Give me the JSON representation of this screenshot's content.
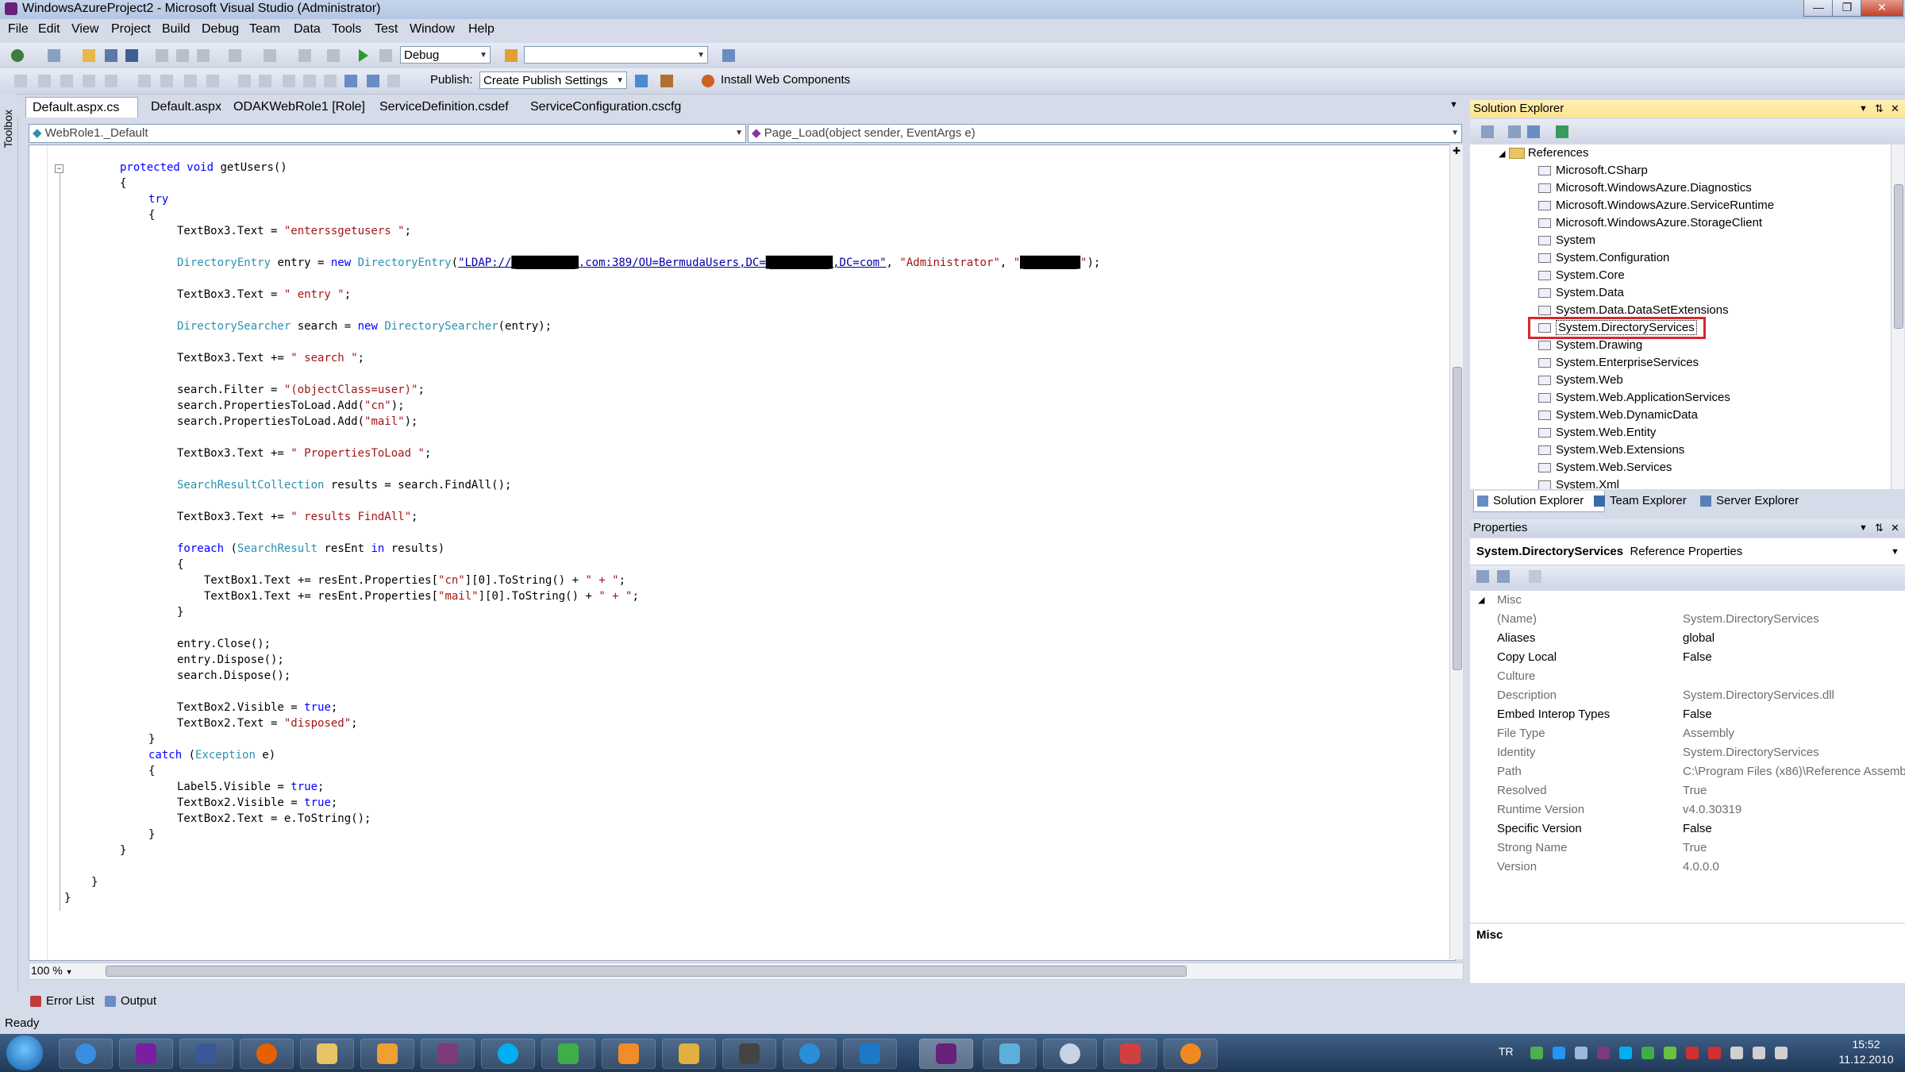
{
  "window": {
    "title": "WindowsAzureProject2 - Microsoft Visual Studio (Administrator)"
  },
  "menu": [
    "File",
    "Edit",
    "View",
    "Project",
    "Build",
    "Debug",
    "Team",
    "Data",
    "Tools",
    "Test",
    "Window",
    "Help"
  ],
  "toolbar": {
    "config": "Debug",
    "publish_label": "Publish:",
    "publish_value": "Create Publish Settings",
    "install_label": "Install Web Components"
  },
  "toolbox_label": "Toolbox",
  "tabs": [
    "Default.aspx.cs",
    "Default.aspx",
    "ODAKWebRole1 [Role]",
    "ServiceDefinition.csdef",
    "ServiceConfiguration.cscfg"
  ],
  "navbar": {
    "class": "WebRole1._Default",
    "member": "Page_Load(object sender, EventArgs e)"
  },
  "code": {
    "l1a": "protected",
    "l1b": "void",
    "l1c": " getUsers()",
    "l2": "{",
    "l3": "try",
    "l4": "{",
    "l5a": "TextBox3.Text = ",
    "l5b": "\"enterssgetusers \"",
    "l5c": ";",
    "l6a": "DirectoryEntry",
    "l6b": " entry = ",
    "l6c": "new",
    "l6d": "DirectoryEntry",
    "l6e": "(",
    "l6f": "\"LDAP://",
    "l6g": "██████████",
    "l6h": ".com:389/OU=BermudaUsers,DC=",
    "l6i": "██████████",
    "l6j": ",DC=com\"",
    "l6k": ", ",
    "l6l": "\"Administrator\"",
    "l6m": ", ",
    "l6n": "\"",
    "l6o": "█████████",
    "l6p": "\"",
    "l6q": ");",
    "l7a": "TextBox3.Text = ",
    "l7b": "\" entry \"",
    "l7c": ";",
    "l8a": "DirectorySearcher",
    "l8b": " search = ",
    "l8c": "new",
    "l8d": "DirectorySearcher",
    "l8e": "(entry);",
    "l9a": "TextBox3.Text += ",
    "l9b": "\" search \"",
    "l9c": ";",
    "l10a": "search.Filter = ",
    "l10b": "\"(objectClass=user)\"",
    "l10c": ";",
    "l11a": "search.PropertiesToLoad.Add(",
    "l11b": "\"cn\"",
    "l11c": ");",
    "l12a": "search.PropertiesToLoad.Add(",
    "l12b": "\"mail\"",
    "l12c": ");",
    "l13a": "TextBox3.Text += ",
    "l13b": "\" PropertiesToLoad \"",
    "l13c": ";",
    "l14a": "SearchResultCollection",
    "l14b": " results = search.FindAll();",
    "l15a": "TextBox3.Text += ",
    "l15b": "\" results FindAll\"",
    "l15c": ";",
    "l16a": "foreach",
    "l16b": " (",
    "l16c": "SearchResult",
    "l16d": " resEnt ",
    "l16e": "in",
    "l16f": " results)",
    "l17": "{",
    "l18a": "TextBox1.Text += resEnt.Properties[",
    "l18b": "\"cn\"",
    "l18c": "][0].ToString() + ",
    "l18d": "\" + \"",
    "l18e": ";",
    "l19a": "TextBox1.Text += resEnt.Properties[",
    "l19b": "\"mail\"",
    "l19c": "][0].ToString() + ",
    "l19d": "\" + \"",
    "l19e": ";",
    "l20": "}",
    "l21": "entry.Close();",
    "l22": "entry.Dispose();",
    "l23": "search.Dispose();",
    "l24a": "TextBox2.Visible = ",
    "l24b": "true",
    "l24c": ";",
    "l25a": "TextBox2.Text = ",
    "l25b": "\"disposed\"",
    "l25c": ";",
    "l26": "}",
    "l27a": "catch",
    "l27b": " (",
    "l27c": "Exception",
    "l27d": " e)",
    "l28": "{",
    "l29a": "Label5.Visible = ",
    "l29b": "true",
    "l29c": ";",
    "l30a": "TextBox2.Visible = ",
    "l30b": "true",
    "l30c": ";",
    "l31": "TextBox2.Text = e.ToString();",
    "l32": "}",
    "l33": "}",
    "l34": "}",
    "l35": "}"
  },
  "zoom": "100 %",
  "solution_explorer": {
    "title": "Solution Explorer",
    "folder": "References",
    "items": [
      "Microsoft.CSharp",
      "Microsoft.WindowsAzure.Diagnostics",
      "Microsoft.WindowsAzure.ServiceRuntime",
      "Microsoft.WindowsAzure.StorageClient",
      "System",
      "System.Configuration",
      "System.Core",
      "System.Data",
      "System.Data.DataSetExtensions",
      "System.DirectoryServices",
      "System.Drawing",
      "System.EnterpriseServices",
      "System.Web",
      "System.Web.ApplicationServices",
      "System.Web.DynamicData",
      "System.Web.Entity",
      "System.Web.Extensions",
      "System.Web.Services",
      "System.Xml"
    ],
    "selected": "System.DirectoryServices",
    "tabs": [
      "Solution Explorer",
      "Team Explorer",
      "Server Explorer"
    ]
  },
  "properties": {
    "title": "Properties",
    "object_name": "System.DirectoryServices",
    "object_type": "Reference Properties",
    "category": "Misc",
    "rows": [
      {
        "name": "(Name)",
        "value": "System.DirectoryServices"
      },
      {
        "name": "Aliases",
        "value": "global"
      },
      {
        "name": "Copy Local",
        "value": "False"
      },
      {
        "name": "Culture",
        "value": ""
      },
      {
        "name": "Description",
        "value": "System.DirectoryServices.dll"
      },
      {
        "name": "Embed Interop Types",
        "value": "False"
      },
      {
        "name": "File Type",
        "value": "Assembly"
      },
      {
        "name": "Identity",
        "value": "System.DirectoryServices"
      },
      {
        "name": "Path",
        "value": "C:\\Program Files (x86)\\Reference Assemb"
      },
      {
        "name": "Resolved",
        "value": "True"
      },
      {
        "name": "Runtime Version",
        "value": "v4.0.30319"
      },
      {
        "name": "Specific Version",
        "value": "False"
      },
      {
        "name": "Strong Name",
        "value": "True"
      },
      {
        "name": "Version",
        "value": "4.0.0.0"
      }
    ],
    "desc_title": "Misc"
  },
  "bottom_tabs": [
    "Error List",
    "Output"
  ],
  "status": "Ready",
  "taskbar": {
    "lang": "TR",
    "time": "15:52",
    "date": "11.12.2010"
  }
}
